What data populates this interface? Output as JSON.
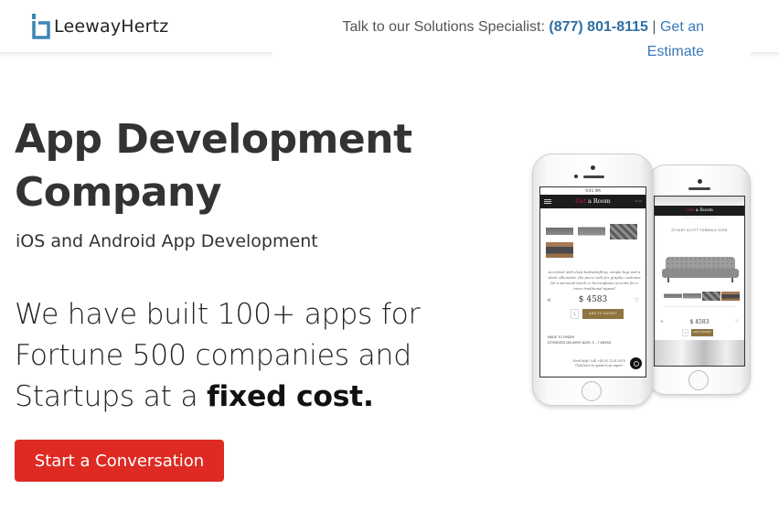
{
  "header": {
    "logo_text": "LeewayHertz",
    "contact_label": "Talk to our Solutions Specialist:",
    "phone": "(877) 801-8115",
    "separator": "|",
    "estimate_link": "Get an Estimate"
  },
  "hero": {
    "title": "App Development Company",
    "subtitle": "iOS and Android App Development",
    "pitch_plain": "We have built 100+ apps for Fortune 500 companies and Startups at a ",
    "pitch_bold": "fixed cost.",
    "cta_label": "Start a Conversation"
  },
  "colors": {
    "brand_blue": "#2f6ea3",
    "cta_red": "#de2a22",
    "heading": "#333333"
  },
  "phone_mockups": {
    "front": {
      "status_time": "9:41 AM",
      "app_brand_accent": "Get",
      "app_brand_rest": " a Room",
      "description": "Accented with deep buttontufting, simple legs and a sleek silhouette, the piece calls for graphic cushions for a personal touch or herringbone accents for a more traditional appeal",
      "price": "$ 4583",
      "quantity": "1",
      "add_button": "ADD TO BASKET",
      "made_to_order": "MADE TO ORDER",
      "delivery": "ESTIMATED DELIVERY DATE: 5 - 7 WEEKS",
      "help_line1": "Need help? Call +44 (0) 1234 5678",
      "help_line2": "Click here to speak to an expert"
    },
    "back": {
      "app_brand_accent": "Get",
      "app_brand_rest": " a Room",
      "product_name": "STUART SCOTT FORMALS SOFA",
      "price": "$ 4583",
      "quantity": "1",
      "add_button": "ADD TO BASKET"
    }
  }
}
